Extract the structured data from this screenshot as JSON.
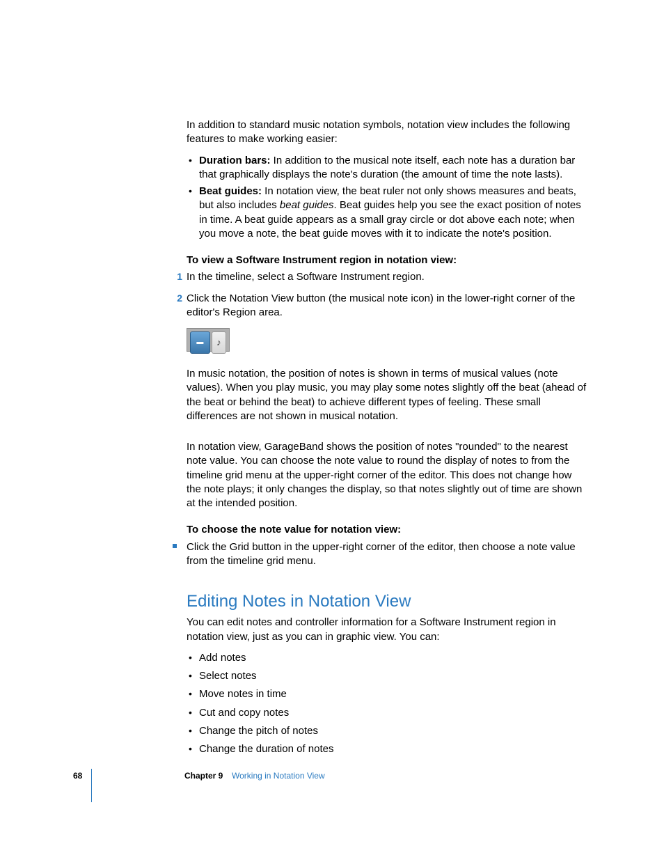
{
  "intro": "In addition to standard music notation symbols, notation view includes the following features to make working easier:",
  "features": [
    {
      "label": "Duration bars:",
      "text": "  In addition to the musical note itself, each note has a duration bar that graphically displays the note's duration (the amount of time the note lasts)."
    },
    {
      "label": "Beat guides:",
      "text_a": "  In notation view, the beat ruler not only shows measures and beats, but also includes ",
      "italic": "beat guides",
      "text_b": ". Beat guides help you see the exact position of notes in time. A beat guide appears as a small gray circle or dot above each note; when you move a note, the beat guide moves with it to indicate the note's position."
    }
  ],
  "task1": {
    "heading": "To view a Software Instrument region in notation view:",
    "steps": [
      "In the timeline, select a Software Instrument region.",
      "Click the Notation View button (the musical note icon) in the lower-right corner of the editor's Region area."
    ]
  },
  "para2": "In music notation, the position of notes is shown in terms of musical values (note values). When you play music, you may play some notes slightly off the beat (ahead of the beat or behind the beat) to achieve different types of feeling. These small differences are not shown in musical notation.",
  "para3": "In notation view, GarageBand shows the position of notes \"rounded\" to the nearest note value. You can choose the note value to round the display of notes to from the timeline grid menu at the upper-right corner of the editor. This does not change how the note plays; it only changes the display, so that notes slightly out of time are shown at the intended position.",
  "task2": {
    "heading": "To choose the note value for notation view:",
    "step": "Click the Grid button in the upper-right corner of the editor, then choose a note value from the timeline grid menu."
  },
  "section": {
    "heading": "Editing Notes in Notation View",
    "intro": "You can edit notes and controller information for a Software Instrument region in notation view, just as you can in graphic view. You can:",
    "items": [
      "Add notes",
      "Select notes",
      "Move notes in time",
      "Cut and copy notes",
      "Change the pitch of notes",
      "Change the duration of notes"
    ]
  },
  "footer": {
    "page": "68",
    "chapter": "Chapter 9",
    "title": "Working in Notation View"
  },
  "icons": {
    "note": "♪",
    "pianoroll": "▬"
  }
}
